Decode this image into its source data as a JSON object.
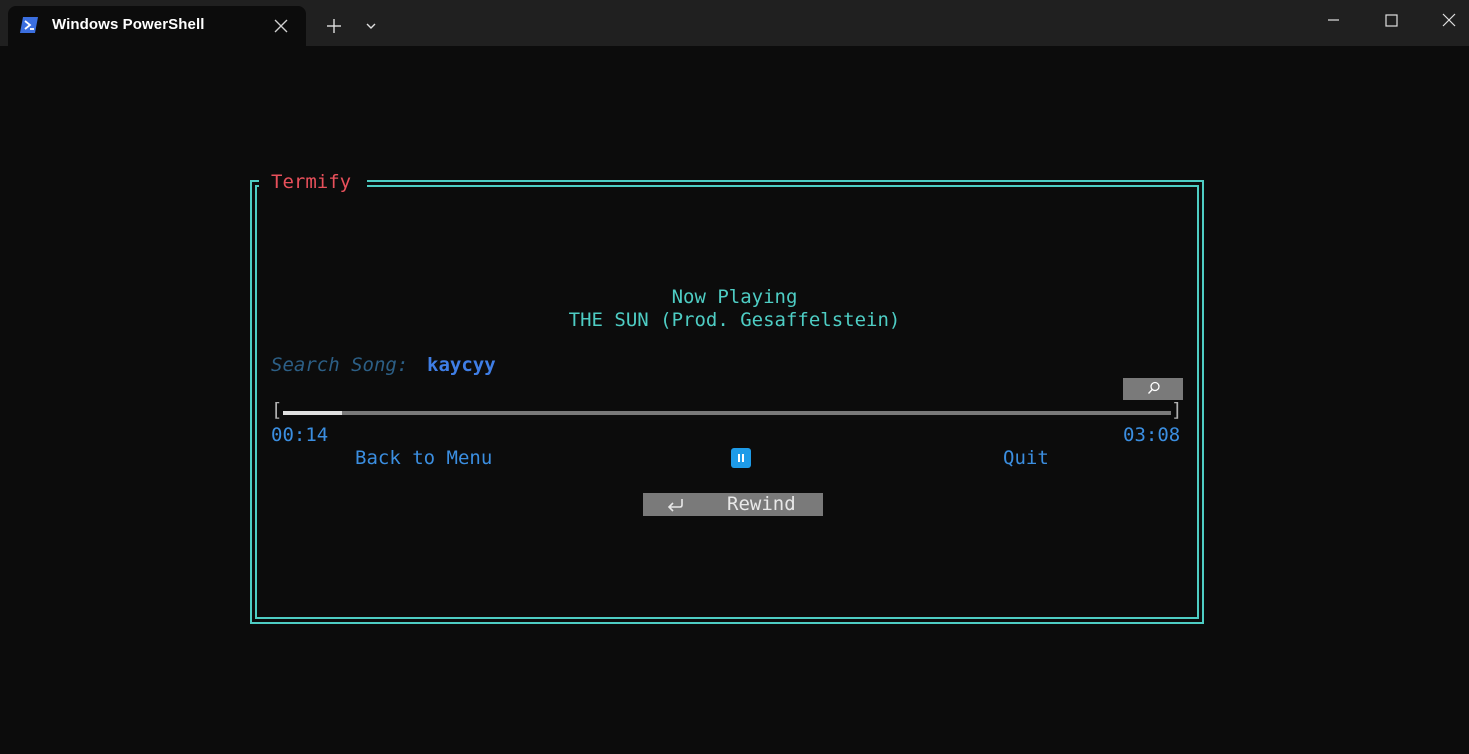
{
  "window": {
    "tab_title": "Windows PowerShell",
    "tab_icon": "powershell-icon"
  },
  "app": {
    "title": "Termify",
    "border_color": "#4ecdc4",
    "title_color": "#e8505b"
  },
  "player": {
    "now_playing_label": "Now Playing",
    "song_title": "THE SUN (Prod. Gesaffelstein)",
    "search_label": "Search Song:",
    "search_value": "kaycyy",
    "search_button_icon": "search-icon",
    "progress_fraction": 0.067,
    "time_current": "00:14",
    "time_total": "03:08",
    "back_label": "Back to Menu",
    "pause_icon": "pause-icon",
    "quit_label": "Quit",
    "rewind_icon": "rewind-arrow-icon",
    "rewind_label": "Rewind"
  },
  "colors": {
    "accent": "#4ecdc4",
    "link": "#3b8ee0",
    "search_value": "#3f7ee6",
    "button_bg": "#7a7a7a"
  }
}
